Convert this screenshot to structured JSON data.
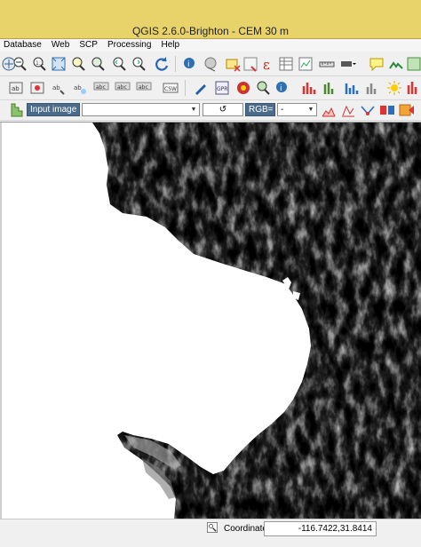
{
  "window": {
    "title": "QGIS 2.6.0-Brighton - CEM 30 m"
  },
  "menu": [
    "Database",
    "Web",
    "SCP",
    "Processing",
    "Help"
  ],
  "scp_toolbar": {
    "input_combo_label": "Input image",
    "band_combo_value": "",
    "rgb_label": "RGB=",
    "rgb_combo_value": "-"
  },
  "status": {
    "coordinate_label": "Coordinate:",
    "coordinate_value": "-116.7422,31.8414"
  },
  "colors": {
    "titlebar": "#e8d36a",
    "map_background": "#000000",
    "land_white": "#ffffff"
  }
}
